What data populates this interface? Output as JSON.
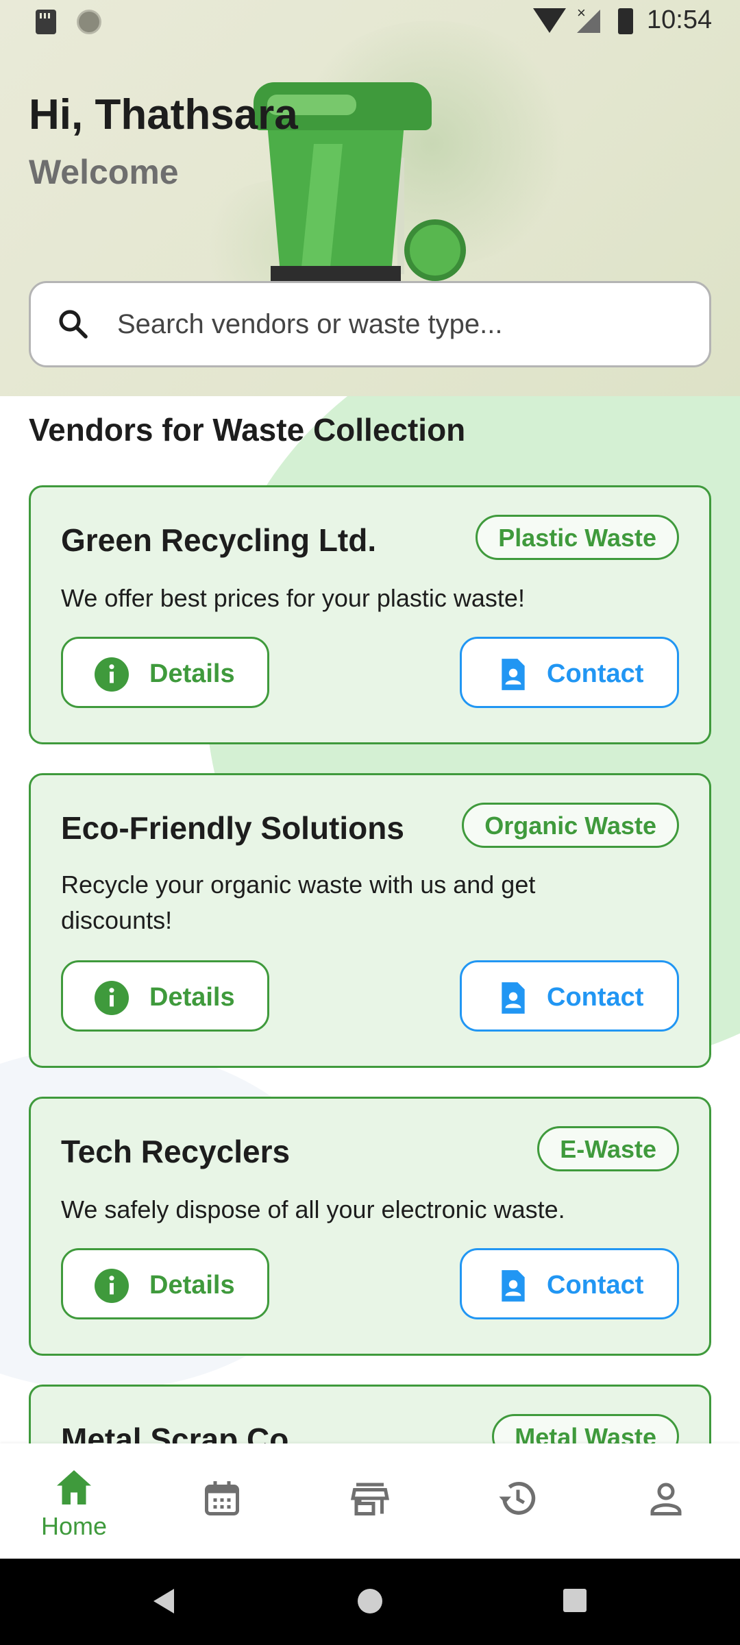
{
  "status_bar": {
    "time": "10:54"
  },
  "header": {
    "greeting": "Hi, Thathsara",
    "welcome": "Welcome"
  },
  "search": {
    "placeholder": "Search vendors or waste type..."
  },
  "section_title": "Vendors for Waste Collection",
  "vendors": [
    {
      "name": "Green Recycling Ltd.",
      "tag": "Plastic Waste",
      "description": "We offer best prices for your plastic waste!",
      "details_label": "Details",
      "contact_label": "Contact"
    },
    {
      "name": "Eco-Friendly Solutions",
      "tag": "Organic Waste",
      "description": "Recycle your organic waste with us and get discounts!",
      "details_label": "Details",
      "contact_label": "Contact"
    },
    {
      "name": "Tech Recyclers",
      "tag": "E-Waste",
      "description": "We safely dispose of all your electronic waste.",
      "details_label": "Details",
      "contact_label": "Contact"
    },
    {
      "name": "Metal Scrap Co.",
      "tag": "Metal Waste"
    }
  ],
  "bottom_nav": {
    "items": [
      {
        "icon": "home-icon",
        "label": "Home",
        "active": true
      },
      {
        "icon": "calendar-icon",
        "label": ""
      },
      {
        "icon": "store-icon",
        "label": ""
      },
      {
        "icon": "history-icon",
        "label": ""
      },
      {
        "icon": "profile-icon",
        "label": ""
      }
    ]
  },
  "colors": {
    "primary_green": "#3f9a3c",
    "contact_blue": "#2196f3",
    "card_bg": "#e8f5e6"
  }
}
